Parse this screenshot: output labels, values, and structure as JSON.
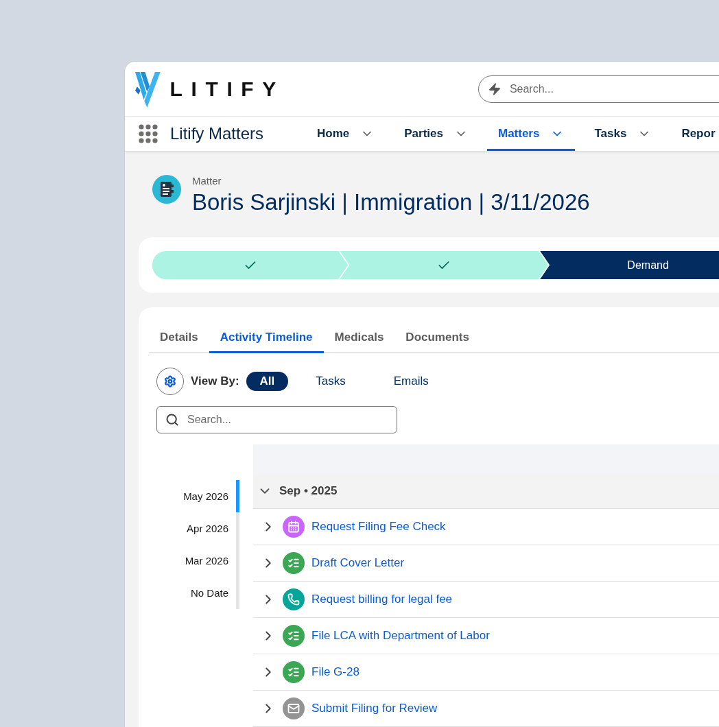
{
  "header": {
    "logo": "LITIFY",
    "search": {
      "placeholder": "Search..."
    }
  },
  "nav": {
    "app_name": "Litify Matters",
    "items": [
      {
        "label": "Home",
        "selected": false,
        "has_menu": true
      },
      {
        "label": "Parties",
        "selected": false,
        "has_menu": true
      },
      {
        "label": "Matters",
        "selected": true,
        "has_menu": true
      },
      {
        "label": "Tasks",
        "selected": false,
        "has_menu": true
      },
      {
        "label": "Repor",
        "selected": false,
        "has_menu": false
      }
    ]
  },
  "record": {
    "type_label": "Matter",
    "title": "Boris Sarjinski | Immigration | 3/11/2026"
  },
  "path": [
    {
      "complete": true
    },
    {
      "complete": true
    },
    {
      "complete": false,
      "label": "Demand"
    }
  ],
  "tabs": [
    {
      "label": "Details",
      "selected": false
    },
    {
      "label": "Activity Timeline",
      "selected": true
    },
    {
      "label": "Medicals",
      "selected": false
    },
    {
      "label": "Documents",
      "selected": false
    }
  ],
  "view_by": {
    "label": "View By:",
    "options": [
      {
        "label": "All",
        "selected": true
      },
      {
        "label": "Tasks",
        "selected": false
      },
      {
        "label": "Emails",
        "selected": false
      }
    ]
  },
  "search": {
    "placeholder": "Search..."
  },
  "date_nav": [
    {
      "label": "May 2026",
      "selected": true
    },
    {
      "label": "Apr 2026",
      "selected": false
    },
    {
      "label": "Mar 2026",
      "selected": false
    },
    {
      "label": "No Date",
      "selected": false
    }
  ],
  "groups": [
    {
      "label": "Sep • 2025",
      "expanded": true,
      "items": [
        {
          "title": "Request Filing Fee Check",
          "kind": "event"
        },
        {
          "title": "Draft Cover Letter",
          "kind": "task"
        },
        {
          "title": "Request billing for legal fee",
          "kind": "call"
        },
        {
          "title": "File LCA with Department of Labor",
          "kind": "task"
        },
        {
          "title": "File G-28",
          "kind": "task"
        },
        {
          "title": "Submit Filing for Review",
          "kind": "email"
        }
      ]
    }
  ]
}
